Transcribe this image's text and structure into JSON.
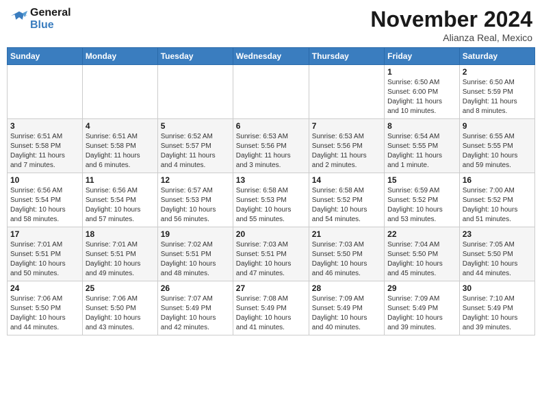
{
  "header": {
    "logo_line1": "General",
    "logo_line2": "Blue",
    "month_title": "November 2024",
    "location": "Alianza Real, Mexico"
  },
  "weekdays": [
    "Sunday",
    "Monday",
    "Tuesday",
    "Wednesday",
    "Thursday",
    "Friday",
    "Saturday"
  ],
  "weeks": [
    [
      {
        "day": "",
        "info": ""
      },
      {
        "day": "",
        "info": ""
      },
      {
        "day": "",
        "info": ""
      },
      {
        "day": "",
        "info": ""
      },
      {
        "day": "",
        "info": ""
      },
      {
        "day": "1",
        "info": "Sunrise: 6:50 AM\nSunset: 6:00 PM\nDaylight: 11 hours\nand 10 minutes."
      },
      {
        "day": "2",
        "info": "Sunrise: 6:50 AM\nSunset: 5:59 PM\nDaylight: 11 hours\nand 8 minutes."
      }
    ],
    [
      {
        "day": "3",
        "info": "Sunrise: 6:51 AM\nSunset: 5:58 PM\nDaylight: 11 hours\nand 7 minutes."
      },
      {
        "day": "4",
        "info": "Sunrise: 6:51 AM\nSunset: 5:58 PM\nDaylight: 11 hours\nand 6 minutes."
      },
      {
        "day": "5",
        "info": "Sunrise: 6:52 AM\nSunset: 5:57 PM\nDaylight: 11 hours\nand 4 minutes."
      },
      {
        "day": "6",
        "info": "Sunrise: 6:53 AM\nSunset: 5:56 PM\nDaylight: 11 hours\nand 3 minutes."
      },
      {
        "day": "7",
        "info": "Sunrise: 6:53 AM\nSunset: 5:56 PM\nDaylight: 11 hours\nand 2 minutes."
      },
      {
        "day": "8",
        "info": "Sunrise: 6:54 AM\nSunset: 5:55 PM\nDaylight: 11 hours\nand 1 minute."
      },
      {
        "day": "9",
        "info": "Sunrise: 6:55 AM\nSunset: 5:55 PM\nDaylight: 10 hours\nand 59 minutes."
      }
    ],
    [
      {
        "day": "10",
        "info": "Sunrise: 6:56 AM\nSunset: 5:54 PM\nDaylight: 10 hours\nand 58 minutes."
      },
      {
        "day": "11",
        "info": "Sunrise: 6:56 AM\nSunset: 5:54 PM\nDaylight: 10 hours\nand 57 minutes."
      },
      {
        "day": "12",
        "info": "Sunrise: 6:57 AM\nSunset: 5:53 PM\nDaylight: 10 hours\nand 56 minutes."
      },
      {
        "day": "13",
        "info": "Sunrise: 6:58 AM\nSunset: 5:53 PM\nDaylight: 10 hours\nand 55 minutes."
      },
      {
        "day": "14",
        "info": "Sunrise: 6:58 AM\nSunset: 5:52 PM\nDaylight: 10 hours\nand 54 minutes."
      },
      {
        "day": "15",
        "info": "Sunrise: 6:59 AM\nSunset: 5:52 PM\nDaylight: 10 hours\nand 53 minutes."
      },
      {
        "day": "16",
        "info": "Sunrise: 7:00 AM\nSunset: 5:52 PM\nDaylight: 10 hours\nand 51 minutes."
      }
    ],
    [
      {
        "day": "17",
        "info": "Sunrise: 7:01 AM\nSunset: 5:51 PM\nDaylight: 10 hours\nand 50 minutes."
      },
      {
        "day": "18",
        "info": "Sunrise: 7:01 AM\nSunset: 5:51 PM\nDaylight: 10 hours\nand 49 minutes."
      },
      {
        "day": "19",
        "info": "Sunrise: 7:02 AM\nSunset: 5:51 PM\nDaylight: 10 hours\nand 48 minutes."
      },
      {
        "day": "20",
        "info": "Sunrise: 7:03 AM\nSunset: 5:51 PM\nDaylight: 10 hours\nand 47 minutes."
      },
      {
        "day": "21",
        "info": "Sunrise: 7:03 AM\nSunset: 5:50 PM\nDaylight: 10 hours\nand 46 minutes."
      },
      {
        "day": "22",
        "info": "Sunrise: 7:04 AM\nSunset: 5:50 PM\nDaylight: 10 hours\nand 45 minutes."
      },
      {
        "day": "23",
        "info": "Sunrise: 7:05 AM\nSunset: 5:50 PM\nDaylight: 10 hours\nand 44 minutes."
      }
    ],
    [
      {
        "day": "24",
        "info": "Sunrise: 7:06 AM\nSunset: 5:50 PM\nDaylight: 10 hours\nand 44 minutes."
      },
      {
        "day": "25",
        "info": "Sunrise: 7:06 AM\nSunset: 5:50 PM\nDaylight: 10 hours\nand 43 minutes."
      },
      {
        "day": "26",
        "info": "Sunrise: 7:07 AM\nSunset: 5:49 PM\nDaylight: 10 hours\nand 42 minutes."
      },
      {
        "day": "27",
        "info": "Sunrise: 7:08 AM\nSunset: 5:49 PM\nDaylight: 10 hours\nand 41 minutes."
      },
      {
        "day": "28",
        "info": "Sunrise: 7:09 AM\nSunset: 5:49 PM\nDaylight: 10 hours\nand 40 minutes."
      },
      {
        "day": "29",
        "info": "Sunrise: 7:09 AM\nSunset: 5:49 PM\nDaylight: 10 hours\nand 39 minutes."
      },
      {
        "day": "30",
        "info": "Sunrise: 7:10 AM\nSunset: 5:49 PM\nDaylight: 10 hours\nand 39 minutes."
      }
    ]
  ]
}
